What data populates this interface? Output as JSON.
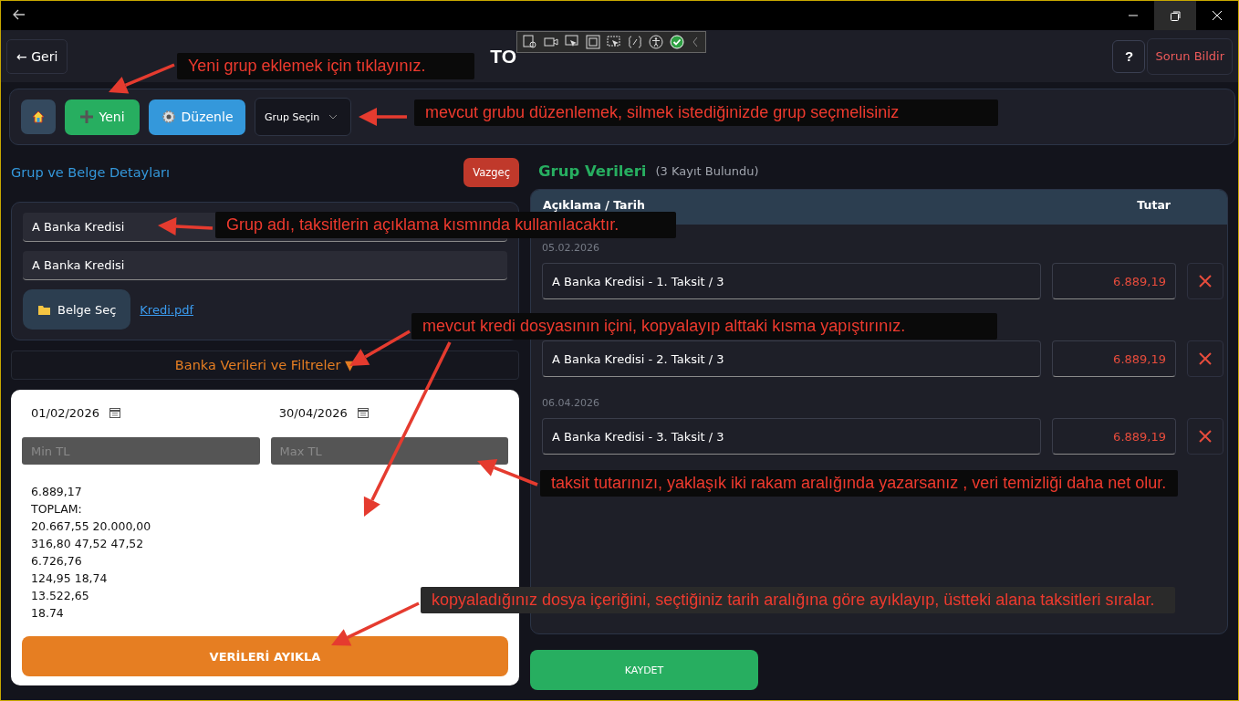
{
  "header": {
    "back_button": "← Geri",
    "title": "TO",
    "help_button": "?",
    "report_button": "Sorun Bildir"
  },
  "toolbar": {
    "new_button": "Yeni",
    "edit_button": "Düzenle",
    "group_select": {
      "placeholder": "Grup Seçin"
    }
  },
  "details": {
    "heading": "Grup ve Belge Detayları",
    "cancel_button": "Vazgeç",
    "group_name": "A Banka Kredisi",
    "description": "A Banka Kredisi",
    "file_button": "Belge Seç",
    "file_link": "Kredi.pdf",
    "filters_toggle": "Banka Verileri ve Filtreler ▼"
  },
  "filters": {
    "start_date": "01/02/2026",
    "end_date": "30/04/2026",
    "min_amount": {
      "placeholder": "Min TL"
    },
    "max_amount": {
      "placeholder": "Max TL"
    },
    "pasted_text": "6.889,17\nTOPLAM:\n20.667,55 20.000,00\n316,80 47,52 47,52\n6.726,76\n124,95 18,74\n13.522,65\n18.74",
    "extract_button": "VERİLERİ AYIKLA"
  },
  "group_data": {
    "heading": "Grup Verileri",
    "count": "(3 Kayıt Bulundu)",
    "columns": [
      "Açıklama / Tarih",
      "Tutar"
    ],
    "rows": [
      {
        "date": "05.02.2026",
        "description": "A Banka Kredisi - 1. Taksit / 3",
        "amount": "6.889,19"
      },
      {
        "description": "A Banka Kredisi - 2. Taksit / 3",
        "amount": "6.889,19"
      },
      {
        "date": "06.04.2026",
        "description": "A Banka Kredisi - 3. Taksit / 3",
        "amount": "6.889,19"
      }
    ]
  },
  "save_button": "KAYDET",
  "callouts": [
    {
      "text": "Yeni grup eklemek için tıklayınız."
    },
    {
      "text": "mevcut grubu düzenlemek, silmek istediğinizde grup seçmelisiniz"
    },
    {
      "text": "Grup adı, taksitlerin açıklama kısmında kullanılacaktır."
    },
    {
      "text": "mevcut kredi dosyasının içini, kopyalayıp alttaki kısma yapıştırınız."
    },
    {
      "text": "taksit tutarınızı, yaklaşık iki rakam aralığında yazarsanız , veri temizliği daha net olur."
    },
    {
      "text": "kopyaladığınız dosya içeriğini, seçtiğiniz tarih aralığına göre ayıklayıp, üstteki alana taksitleri sıralar."
    }
  ]
}
